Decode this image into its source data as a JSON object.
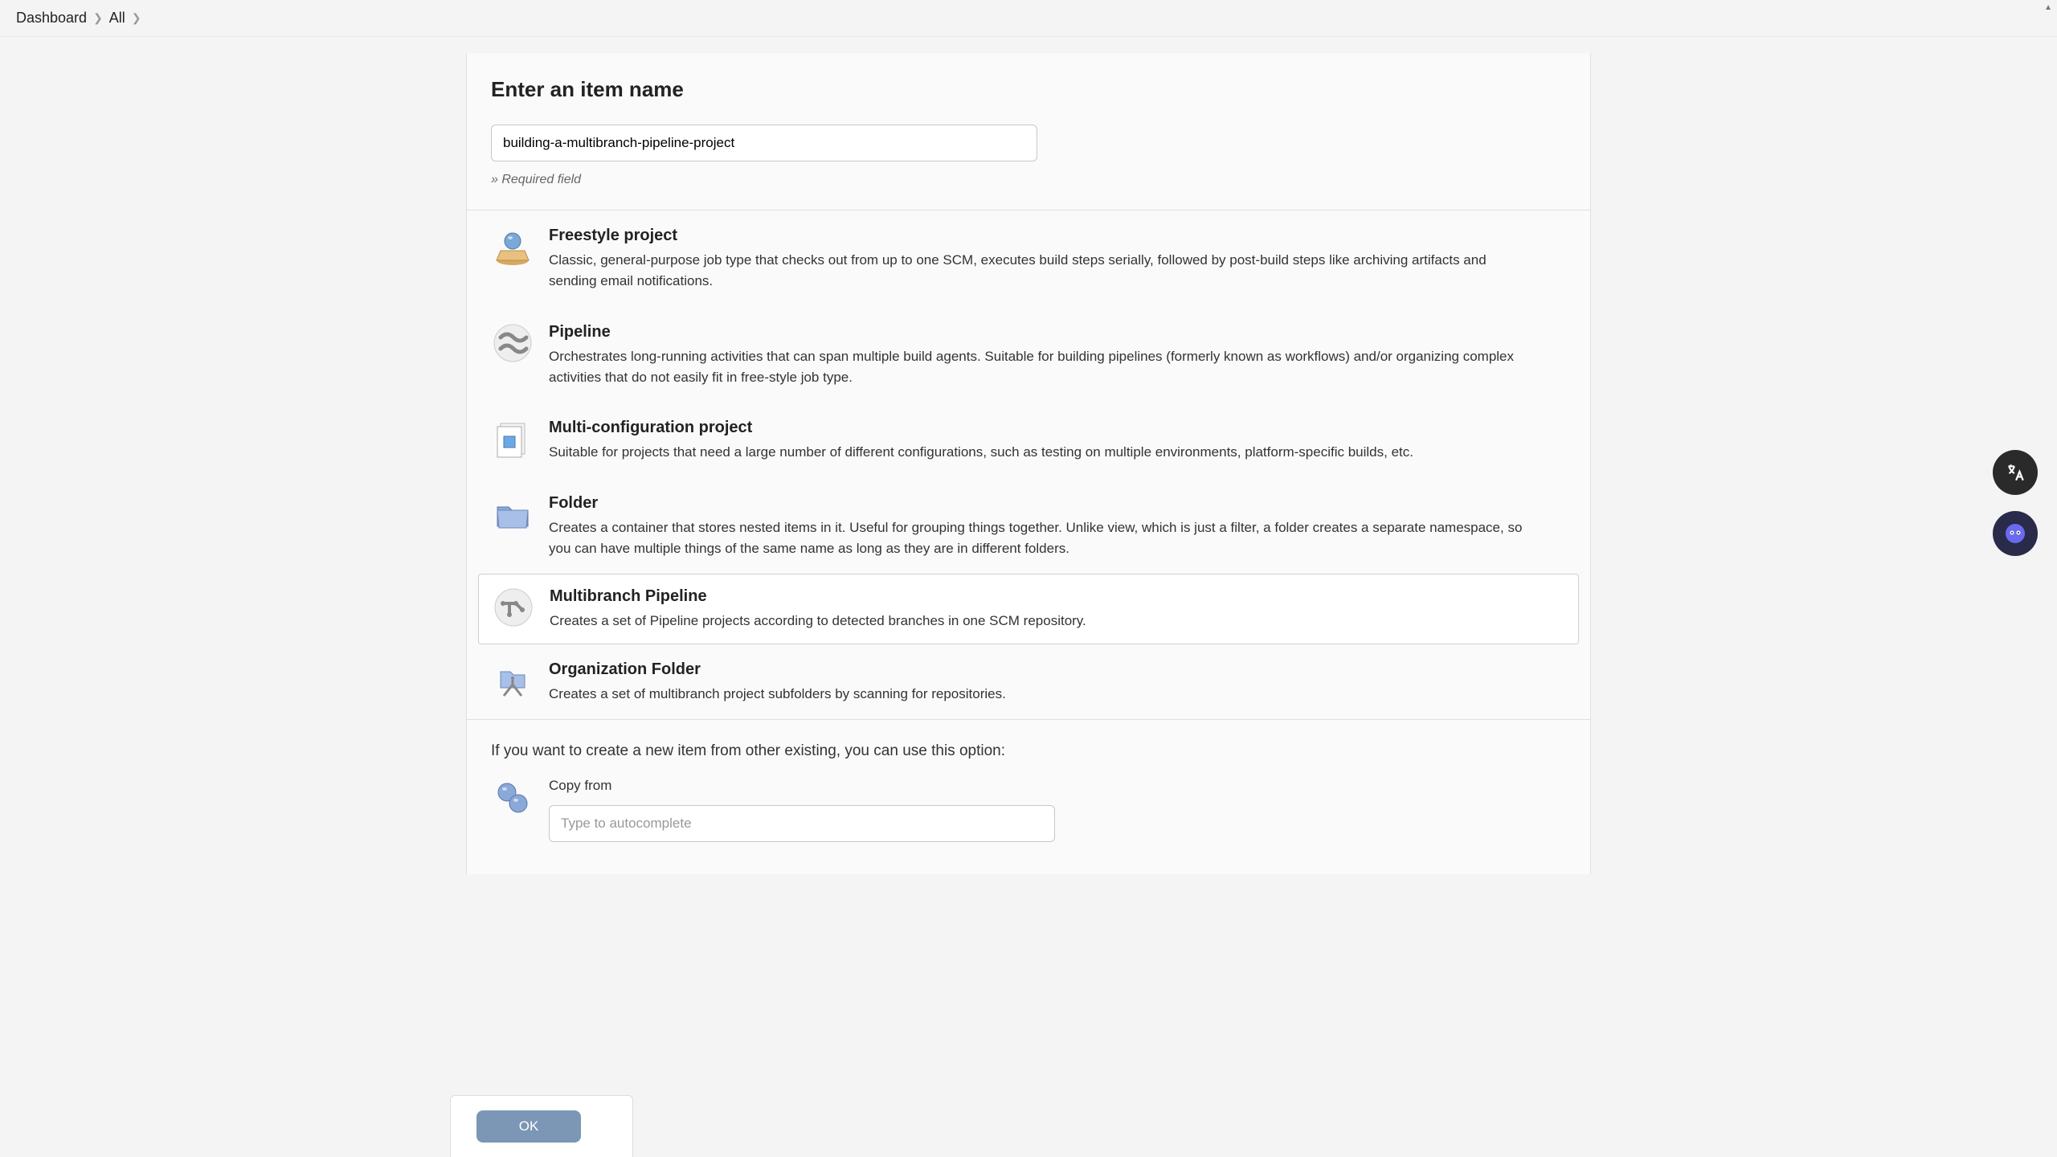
{
  "breadcrumb": {
    "items": [
      "Dashboard",
      "All"
    ]
  },
  "name_section": {
    "title": "Enter an item name",
    "value": "building-a-multibranch-pipeline-project",
    "required_hint": "» Required field"
  },
  "options": [
    {
      "id": "freestyle",
      "title": "Freestyle project",
      "desc": "Classic, general-purpose job type that checks out from up to one SCM, executes build steps serially, followed by post-build steps like archiving artifacts and sending email notifications.",
      "selected": false
    },
    {
      "id": "pipeline",
      "title": "Pipeline",
      "desc": "Orchestrates long-running activities that can span multiple build agents. Suitable for building pipelines (formerly known as workflows) and/or organizing complex activities that do not easily fit in free-style job type.",
      "selected": false
    },
    {
      "id": "multiconfig",
      "title": "Multi-configuration project",
      "desc": "Suitable for projects that need a large number of different configurations, such as testing on multiple environments, platform-specific builds, etc.",
      "selected": false
    },
    {
      "id": "folder",
      "title": "Folder",
      "desc": "Creates a container that stores nested items in it. Useful for grouping things together. Unlike view, which is just a filter, a folder creates a separate namespace, so you can have multiple things of the same name as long as they are in different folders.",
      "selected": false
    },
    {
      "id": "multibranch",
      "title": "Multibranch Pipeline",
      "desc": "Creates a set of Pipeline projects according to detected branches in one SCM repository.",
      "selected": true
    },
    {
      "id": "orgfolder",
      "title": "Organization Folder",
      "desc": "Creates a set of multibranch project subfolders by scanning for repositories.",
      "selected": false
    }
  ],
  "copy_section": {
    "hint": "If you want to create a new item from other existing, you can use this option:",
    "label": "Copy from",
    "placeholder": "Type to autocomplete"
  },
  "footer": {
    "ok_label": "OK"
  }
}
